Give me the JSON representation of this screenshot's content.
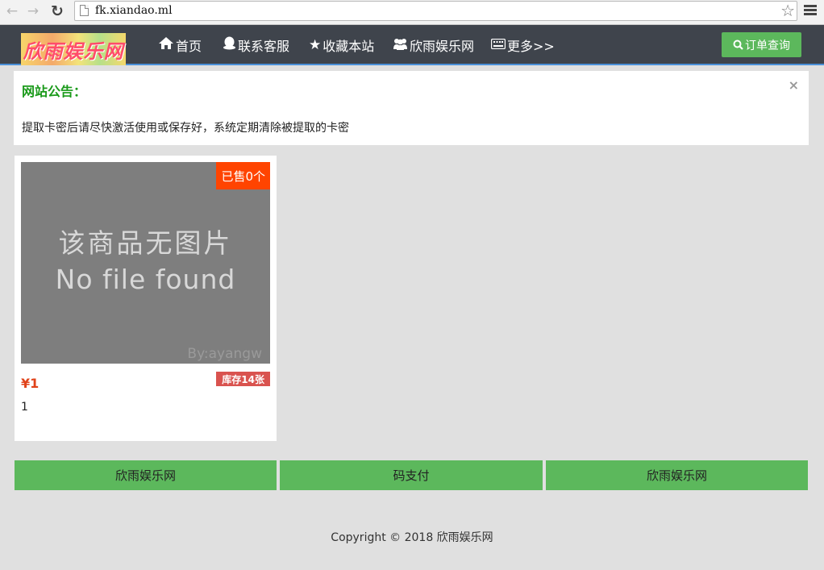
{
  "browser": {
    "url": "fk.xiandao.ml"
  },
  "navbar": {
    "logo_text": "欣雨娱乐网",
    "items": [
      {
        "label": "首页",
        "icon": "home-icon"
      },
      {
        "label": "联系客服",
        "icon": "qq-penguin-icon"
      },
      {
        "label": "收藏本站",
        "icon": "star-icon"
      },
      {
        "label": "欣雨娱乐网",
        "icon": "users-icon"
      },
      {
        "label": "更多>>",
        "icon": "keyboard-icon"
      }
    ],
    "order_query_label": "订单查询",
    "order_query_icon": "search-icon"
  },
  "notice": {
    "title": "网站公告：",
    "close": "×",
    "text": "提取卡密后请尽快激活使用或保存好，系统定期清除被提取的卡密"
  },
  "product": {
    "placeholder_cn": "该商品无图片",
    "placeholder_en": "No file found",
    "placeholder_by": "By:ayangw",
    "sold_label": "已售0个",
    "price": "¥1",
    "stock_label": "库存14张",
    "name": "1"
  },
  "footer_buttons": [
    {
      "label": "欣雨娱乐网"
    },
    {
      "label": "码支付"
    },
    {
      "label": "欣雨娱乐网"
    }
  ],
  "copyright": "Copyright © 2018 欣雨娱乐网",
  "colors": {
    "navbar_bg": "#3f444c",
    "accent_green": "#5cb85c",
    "sold_badge": "#ff4400",
    "stock_badge": "#d9534f",
    "price": "#e0431a",
    "notice_title": "#1a9a1a"
  }
}
